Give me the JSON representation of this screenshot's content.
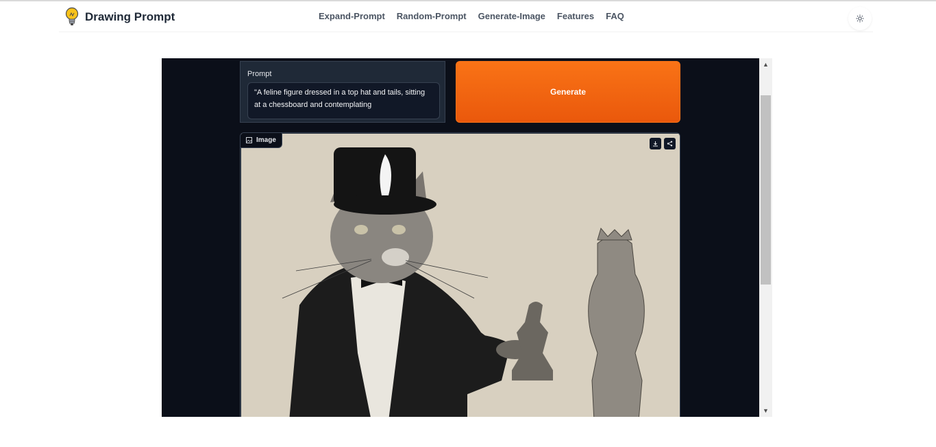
{
  "header": {
    "brand": "Drawing Prompt",
    "nav": [
      "Expand-Prompt",
      "Random-Prompt",
      "Generate-Image",
      "Features",
      "FAQ"
    ]
  },
  "prompt": {
    "label": "Prompt",
    "value": "\"A feline figure dressed in a top hat and tails, sitting at a chessboard and contemplating"
  },
  "generate": {
    "label": "Generate"
  },
  "image": {
    "label": "Image"
  },
  "colors": {
    "accent": "#f97316",
    "frame_bg": "#0b0f19",
    "panel_bg": "#1f2937"
  }
}
